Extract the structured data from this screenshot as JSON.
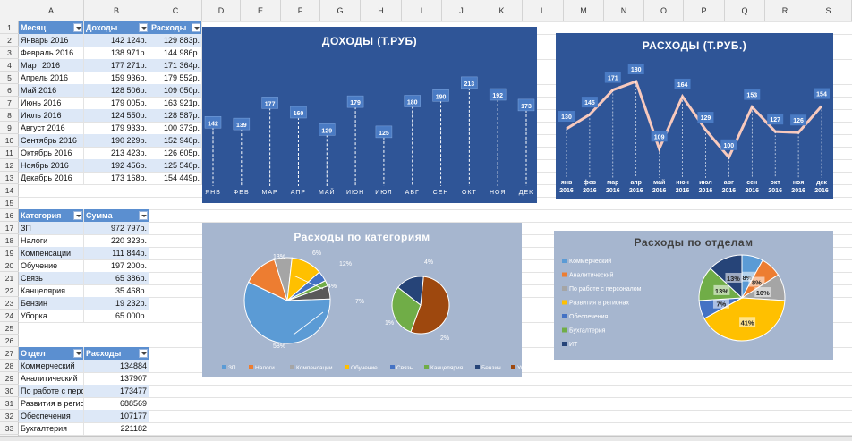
{
  "columns": [
    "A",
    "B",
    "C",
    "D",
    "E",
    "F",
    "G",
    "H",
    "I",
    "J",
    "K",
    "L",
    "M",
    "N",
    "O",
    "P",
    "Q",
    "R",
    "S"
  ],
  "rows": [
    "1",
    "2",
    "3",
    "4",
    "5",
    "6",
    "7",
    "8",
    "9",
    "10",
    "11",
    "12",
    "13",
    "14",
    "15",
    "16",
    "17",
    "18",
    "19",
    "20",
    "21",
    "22",
    "23",
    "24",
    "25",
    "26",
    "27",
    "28",
    "29",
    "30",
    "31",
    "32",
    "33"
  ],
  "monthly_table": {
    "headers": [
      "Месяц",
      "Доходы",
      "Расходы"
    ],
    "rows": [
      [
        "Январь 2016",
        "142 124р.",
        "129 883р."
      ],
      [
        "Февраль 2016",
        "138 971р.",
        "144 986р."
      ],
      [
        "Март 2016",
        "177 271р.",
        "171 364р."
      ],
      [
        "Апрель 2016",
        "159 936р.",
        "179 552р."
      ],
      [
        "Май 2016",
        "128 506р.",
        "109 050р."
      ],
      [
        "Июнь 2016",
        "179 005р.",
        "163 921р."
      ],
      [
        "Июль 2016",
        "124 550р.",
        "128 587р."
      ],
      [
        "Август 2016",
        "179 933р.",
        "100 373р."
      ],
      [
        "Сентябрь 2016",
        "190 229р.",
        "152 940р."
      ],
      [
        "Октябрь 2016",
        "213 423р.",
        "126 605р."
      ],
      [
        "Ноябрь 2016",
        "192 456р.",
        "125 540р."
      ],
      [
        "Декабрь 2016",
        "173 168р.",
        "154 449р."
      ]
    ]
  },
  "category_table": {
    "headers": [
      "Категория",
      "Сумма"
    ],
    "rows": [
      [
        "ЗП",
        "972 797р."
      ],
      [
        "Налоги",
        "220 323р."
      ],
      [
        "Компенсации",
        "111 844р."
      ],
      [
        "Обучение",
        "197 200р."
      ],
      [
        "Связь",
        "65 386р."
      ],
      [
        "Канцелярия",
        "35 468р."
      ],
      [
        "Бензин",
        "19 232р."
      ],
      [
        "Уборка",
        "65 000р."
      ]
    ]
  },
  "dept_table": {
    "headers": [
      "Отдел",
      "Расходы"
    ],
    "rows": [
      [
        "Коммерческий",
        "134884"
      ],
      [
        "Аналитический",
        "137907"
      ],
      [
        "По работе с персо",
        "173477"
      ],
      [
        "Развития в регио",
        "688569"
      ],
      [
        "Обеспечения",
        "107177"
      ],
      [
        "Бухгалтерия",
        "221182"
      ]
    ]
  },
  "colors": {
    "chart_bg": "#2f5597",
    "pie_bg": "#a6b6cf",
    "table_header": "#5b8fd0",
    "table_band": "#dde8f7",
    "line": "#f4b6a8"
  },
  "chart_data": [
    {
      "type": "line",
      "title": "ДОХОДЫ (Т.РУБ)",
      "categories": [
        "ЯНВ",
        "ФЕВ",
        "МАР",
        "АПР",
        "МАЙ",
        "ИЮН",
        "ИЮЛ",
        "АВГ",
        "СЕН",
        "ОКТ",
        "НОЯ",
        "ДЕК"
      ],
      "values": [
        142,
        139,
        177,
        160,
        129,
        179,
        125,
        180,
        190,
        213,
        192,
        173
      ],
      "ylim": [
        0,
        240
      ],
      "grid": false,
      "legend": "none"
    },
    {
      "type": "line",
      "title": "РАСХОДЫ (Т.РУБ.)",
      "categories": [
        "янв 2016",
        "фев 2016",
        "мар 2016",
        "апр 2016",
        "май 2016",
        "июн 2016",
        "июл 2016",
        "авг 2016",
        "сен 2016",
        "окт 2016",
        "ноя 2016",
        "дек 2016"
      ],
      "values": [
        130,
        145,
        171,
        180,
        109,
        164,
        129,
        100,
        153,
        127,
        126,
        154
      ],
      "ylim": [
        0,
        200
      ],
      "grid": false,
      "legend": "none"
    },
    {
      "type": "pie",
      "title": "Расходы по категориям",
      "labels": [
        "ЗП",
        "Налоги",
        "Компенсации",
        "Обучение",
        "Связь",
        "Канцелярия",
        "Бензин",
        "Уборка"
      ],
      "values": [
        972797,
        220323,
        111844,
        197200,
        65386,
        35468,
        19232,
        65000
      ],
      "percent_labels": [
        "58%",
        "13%",
        "6%",
        "12%",
        "4%",
        "7%",
        "1%",
        "2%",
        "4%"
      ],
      "colors": [
        "#5b9bd5",
        "#ed7d31",
        "#a5a5a5",
        "#ffc000",
        "#4472c4",
        "#70ad47",
        "#264478",
        "#9e480e"
      ],
      "legend": "bottom"
    },
    {
      "type": "pie",
      "title": "Расходы по отделам",
      "labels": [
        "Коммерческий",
        "Аналитический",
        "По работе с персоналом",
        "Развития в регионах",
        "Обеспечения",
        "Бухгалтерия",
        "ИТ"
      ],
      "percent_labels": [
        "8%",
        "8%",
        "10%",
        "41%",
        "7%",
        "13%",
        "13%"
      ],
      "values": [
        8,
        8,
        10,
        41,
        7,
        13,
        13
      ],
      "colors": [
        "#5b9bd5",
        "#ed7d31",
        "#a5a5a5",
        "#ffc000",
        "#4472c4",
        "#70ad47",
        "#264478"
      ],
      "legend": "left"
    }
  ]
}
